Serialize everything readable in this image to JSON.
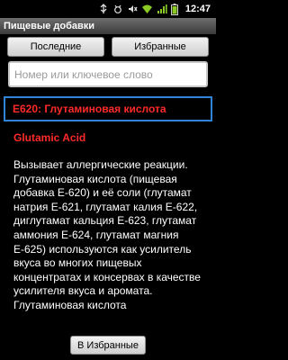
{
  "status_bar": {
    "time": "12:47",
    "icons": [
      "usb-icon",
      "debug-icon",
      "mute-icon",
      "wifi-icon",
      "signal-icon",
      "battery-icon"
    ],
    "accent_color": "#8ac926"
  },
  "app": {
    "title": "Пищевые добавки"
  },
  "tabs": {
    "recent": "Последние",
    "favorites": "Избранные"
  },
  "search": {
    "placeholder": "Номер или ключевое слово"
  },
  "entry": {
    "title": "Е620: Глутаминовая кислота",
    "english_name": "Glutamic Acid",
    "description": "Вызывает аллергические реакции. Глутаминовая кислота (пищевая добавка Е-620) и её соли (глутамат натрия Е-621, глутамат калия Е-622, диглутамат кальция Е-623, глутамат аммония Е-624, глутамат магния Е-625) используются как усилитель вкуса во многих пищевых концентратах и консервах в качестве усилителя вкуса и аромата. Глутаминовая кислота"
  },
  "actions": {
    "add_favorite": "В Избранные"
  },
  "colors": {
    "entry_title": "#ff2a2a",
    "selection_border": "#2f84d8"
  }
}
